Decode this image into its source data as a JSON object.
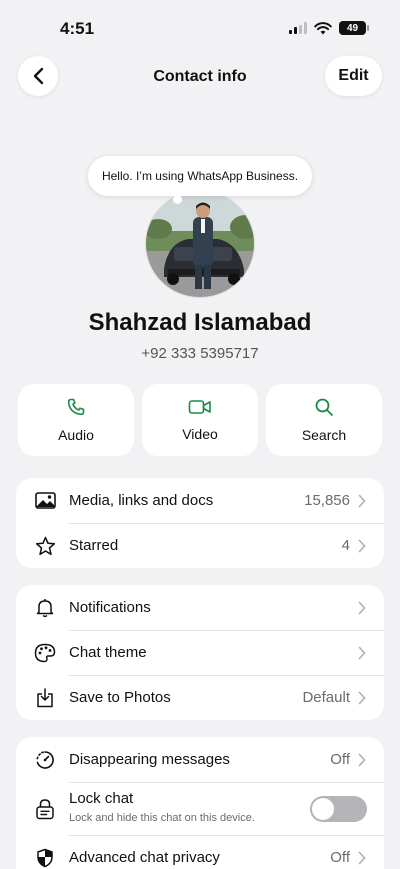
{
  "status_bar": {
    "time": "4:51",
    "battery": "49"
  },
  "nav": {
    "title": "Contact info",
    "edit_label": "Edit"
  },
  "profile": {
    "status_message": "Hello. I’m using WhatsApp Business.",
    "name": "Shahzad Islamabad",
    "phone": "+92 333 5395717"
  },
  "actions": [
    {
      "label": "Audio",
      "icon": "phone-icon"
    },
    {
      "label": "Video",
      "icon": "video-icon"
    },
    {
      "label": "Search",
      "icon": "search-icon"
    }
  ],
  "group1": [
    {
      "label": "Media, links and docs",
      "value": "15,856",
      "icon": "photo-icon"
    },
    {
      "label": "Starred",
      "value": "4",
      "icon": "star-icon"
    }
  ],
  "group2": [
    {
      "label": "Notifications",
      "value": "",
      "icon": "bell-icon"
    },
    {
      "label": "Chat theme",
      "value": "",
      "icon": "palette-icon"
    },
    {
      "label": "Save to Photos",
      "value": "Default",
      "icon": "save-icon"
    }
  ],
  "group3": {
    "disappearing": {
      "label": "Disappearing messages",
      "value": "Off",
      "icon": "timer-icon"
    },
    "lock": {
      "label": "Lock chat",
      "sublabel": "Lock and hide this chat on this device.",
      "icon": "lock-icon",
      "enabled": false
    },
    "privacy": {
      "label": "Advanced chat privacy",
      "value": "Off",
      "icon": "shield-icon"
    }
  },
  "colors": {
    "accent": "#1a8a4a",
    "background": "#f2f2f4"
  }
}
